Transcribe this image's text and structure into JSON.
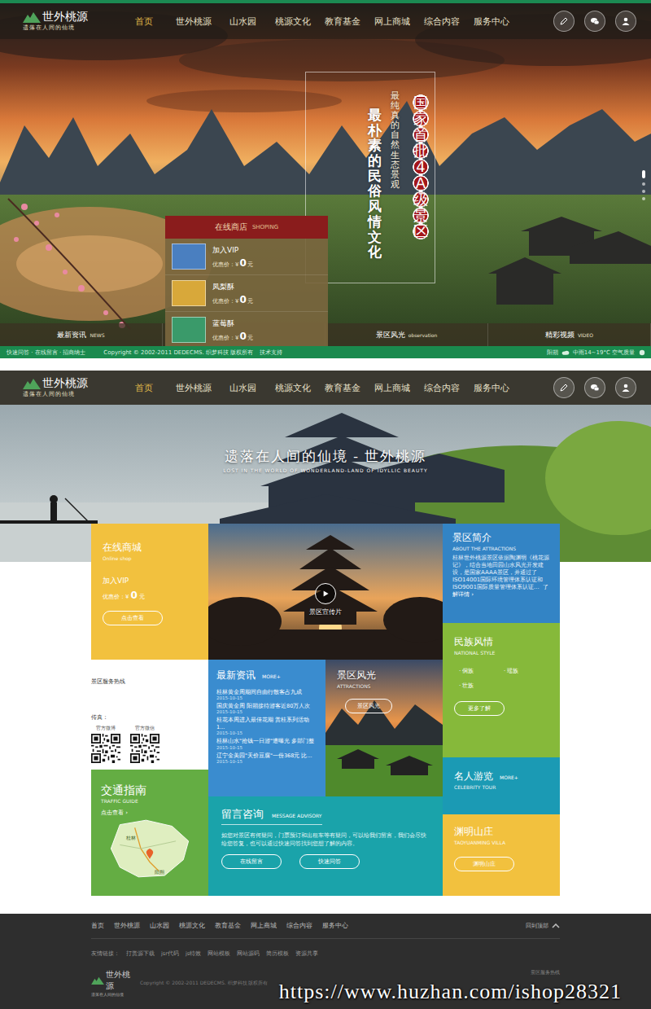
{
  "site": {
    "logo_title": "世外桃源",
    "logo_subtitle": "遗落在人间的仙境"
  },
  "nav": [
    {
      "label": "首页",
      "selected": true
    },
    {
      "label": "世外桃源",
      "selected": false
    },
    {
      "label": "山水园",
      "selected": false
    },
    {
      "label": "桃源文化",
      "selected": false
    },
    {
      "label": "教育基金",
      "selected": false
    },
    {
      "label": "网上商城",
      "selected": false
    },
    {
      "label": "综合内容",
      "selected": false
    },
    {
      "label": "服务中心",
      "selected": false
    }
  ],
  "hero": {
    "badge": "国家首批4A级景区",
    "headline": "最朴素的民俗风情文化",
    "subline": "最纯真的自然生态景观",
    "slides": [
      {
        "selected": true
      },
      {
        "selected": false
      },
      {
        "selected": false
      },
      {
        "selected": false
      }
    ]
  },
  "shop": {
    "title": "在线商店",
    "title_en": "SHOPING",
    "price_label": "优惠价：",
    "items": [
      {
        "name": "加入VIP",
        "currency": "¥",
        "price": "0",
        "unit": "元",
        "color": "#4a7fc0"
      },
      {
        "name": "凤梨酥",
        "currency": "¥",
        "price": "0",
        "unit": "元",
        "color": "#d8a83a"
      },
      {
        "name": "蓝莓酥",
        "currency": "¥",
        "price": "0",
        "unit": "元",
        "color": "#3a9a6a"
      }
    ]
  },
  "hero_tabs": [
    {
      "label": "最新资讯",
      "en": "NEWS"
    },
    {
      "label": "景区风光",
      "en": "observation"
    },
    {
      "label": "精彩视频",
      "en": "VIDEO"
    }
  ],
  "topbar": {
    "links": "快速问答 · 在线留言 · 招商纳士",
    "copyright": "Copyright © 2002-2011 DEDECMS. 织梦科技 版权所有",
    "support": "技术支持",
    "city": "阳朔",
    "weather": "中雨14~19°C 空气质量"
  },
  "banner": {
    "title": "遗落在人间的仙境 - 世外桃源",
    "subtitle": "LOST IN THE WORLD OF WONDERLAND-LAND OF IDYLLIC BEAUTY"
  },
  "online_shop": {
    "title": "在线商城",
    "title_en": "Online shop",
    "item": "加入VIP",
    "price_label": "优惠价：",
    "currency": "¥",
    "price": "0",
    "unit": "元",
    "button": "点击查看"
  },
  "video": {
    "label": "景区宣传片"
  },
  "about": {
    "title": "景区简介",
    "title_en": "ABOUT THE ATTRACTIONS",
    "text": "桂林世外桃源景区依据陶渊明《桃花源记》，结合当地田园山水风光开发建设，是国家AAAA景区，并通过了ISO14001国际环境管理体系认证和ISO9001国际质量管理体系认证…",
    "link": "了解详情 ›"
  },
  "ethnic": {
    "title": "民族风情",
    "title_en": "NATIONAL STYLE",
    "bullet": "·",
    "items": [
      "侗族",
      "瑶族",
      "壮族"
    ],
    "button": "更多了解"
  },
  "contact": {
    "hotline": "景区服务热线",
    "fax": "传真：",
    "qr": [
      {
        "label": "官方微博"
      },
      {
        "label": "官方微信"
      }
    ]
  },
  "news": {
    "title": "最新资讯",
    "more": "MORE+",
    "items": [
      {
        "title": "桂林黄金周期间自由行散客占九成",
        "date": "2015-10-15"
      },
      {
        "title": "国庆黄金周 阳朔接待游客近80万人次",
        "date": "2015-10-15"
      },
      {
        "title": "桂花本周进入最佳花期 赏桂系列活动1...",
        "date": "2015-10-15"
      },
      {
        "title": "桂林山水\"抢钱一日游\"遭曝光 多部门整",
        "date": "2015-10-15"
      },
      {
        "title": "辽宁金美园\"天价豆腐\"一份368元 比...",
        "date": "2015-10-15"
      }
    ]
  },
  "scenery": {
    "title": "景区风光",
    "title_en": "ATTRACTIONS",
    "button": "景区风光"
  },
  "traffic": {
    "title": "交通指南",
    "title_en": "TRAFFIC GUIDE",
    "link": "点击查看 ›",
    "map_labels": [
      "桂林",
      "阳朔"
    ]
  },
  "message": {
    "title": "留言咨询",
    "title_en": "MESSAGE ADVISORY",
    "text": "如您对景区有何疑问，门票预订和出租车等有疑问，可以给我们留言，我们会尽快给您答复，也可以通过快速问答找到您想了解的内容。",
    "buttons": [
      "在线留言",
      "快速问答"
    ]
  },
  "celebrity": {
    "title": "名人游览",
    "title_en": "CELEBRITY TOUR",
    "more": "MORE+"
  },
  "villa": {
    "title": "渊明山庄",
    "title_en": "TAOYUANMING VILLA",
    "button": "渊明山庄"
  },
  "footer": {
    "back_to_top": "回到顶部",
    "friends_label": "友情链接：",
    "friends": [
      "打赏源下载",
      "jsr代码",
      "js特效",
      "网站模板",
      "网站源码",
      "简历模板",
      "资源共享"
    ],
    "copyright": "Copyright © 2002-2011 DEDECMS. 织梦科技 版权所有",
    "hotline": "景区服务热线"
  },
  "watermark": "https://www.huzhan.com/ishop28321"
}
